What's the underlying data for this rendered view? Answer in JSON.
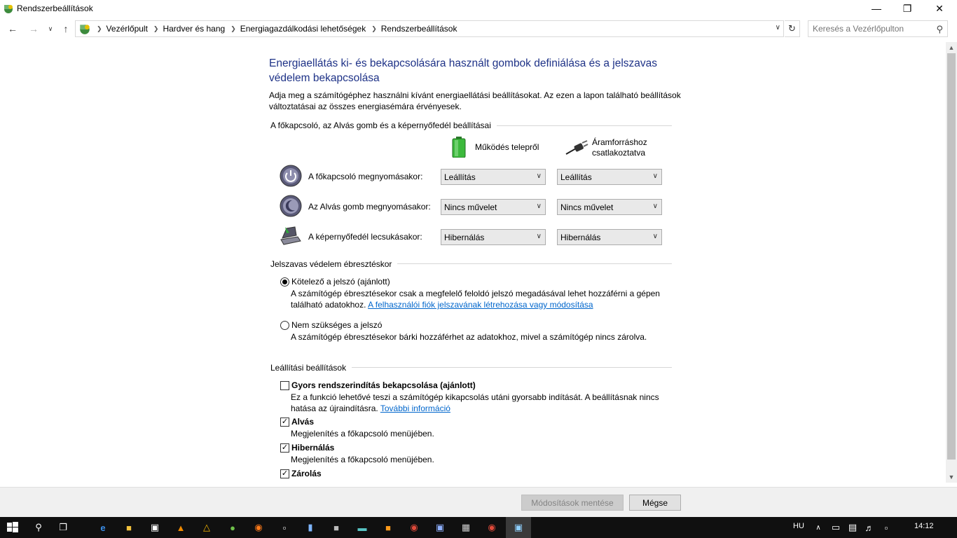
{
  "window": {
    "title": "Rendszerbeállítások"
  },
  "nav": {
    "breadcrumbs": [
      "Vezérlőpult",
      "Hardver és hang",
      "Energiagazdálkodási lehetőségek",
      "Rendszerbeállítások"
    ],
    "search_placeholder": "Keresés a Vezérlőpulton"
  },
  "page": {
    "title": "Energiaellátás ki- és bekapcsolására használt gombok definiálása és a jelszavas védelem bekapcsolása",
    "intro": "Adja meg a számítógéphez használni kívánt energiaellátási beállításokat. Az ezen a lapon található beállítások változtatásai az összes energiasémára érvényesek."
  },
  "buttons_section": {
    "heading": "A főkapcsoló, az Alvás gomb és a képernyőfedél beállításai",
    "col_battery": "Működés telepről",
    "col_plugged_1": "Áramforráshoz",
    "col_plugged_2": "csatlakoztatva",
    "rows": [
      {
        "label": "A főkapcsoló megnyomásakor:",
        "battery": "Leállítás",
        "plugged": "Leállítás"
      },
      {
        "label": "Az Alvás gomb megnyomásakor:",
        "battery": "Nincs művelet",
        "plugged": "Nincs művelet"
      },
      {
        "label": "A képernyőfedél lecsukásakor:",
        "battery": "Hibernálás",
        "plugged": "Hibernálás"
      }
    ]
  },
  "password_section": {
    "heading": "Jelszavas védelem ébresztéskor",
    "opt1_label": "Kötelező a jelszó (ajánlott)",
    "opt1_desc": "A számítógép ébresztésekor csak a megfelelő feloldó jelszó megadásával lehet hozzáférni a gépen található adatokhoz.",
    "opt1_link": "A felhasználói fiók jelszavának létrehozása vagy módosítása",
    "opt2_label": "Nem szükséges a jelszó",
    "opt2_desc": "A számítógép ébresztésekor bárki hozzáférhet az adatokhoz, mivel a számítógép nincs zárolva."
  },
  "shutdown_section": {
    "heading": "Leállítási beállítások",
    "fast_label": "Gyors rendszerindítás bekapcsolása (ajánlott)",
    "fast_desc": "Ez a funkció lehetővé teszi a számítógép kikapcsolás utáni gyorsabb indítását. A beállításnak nincs hatása az újraindításra.",
    "fast_link": "További információ",
    "sleep_label": "Alvás",
    "sleep_desc": "Megjelenítés a főkapcsoló menüjében.",
    "hibernate_label": "Hibernálás",
    "hibernate_desc": "Megjelenítés a főkapcsoló menüjében.",
    "lock_label": "Zárolás"
  },
  "footer": {
    "save": "Módosítások mentése",
    "cancel": "Mégse"
  },
  "taskbar": {
    "lang": "HU",
    "time": "14:12"
  }
}
